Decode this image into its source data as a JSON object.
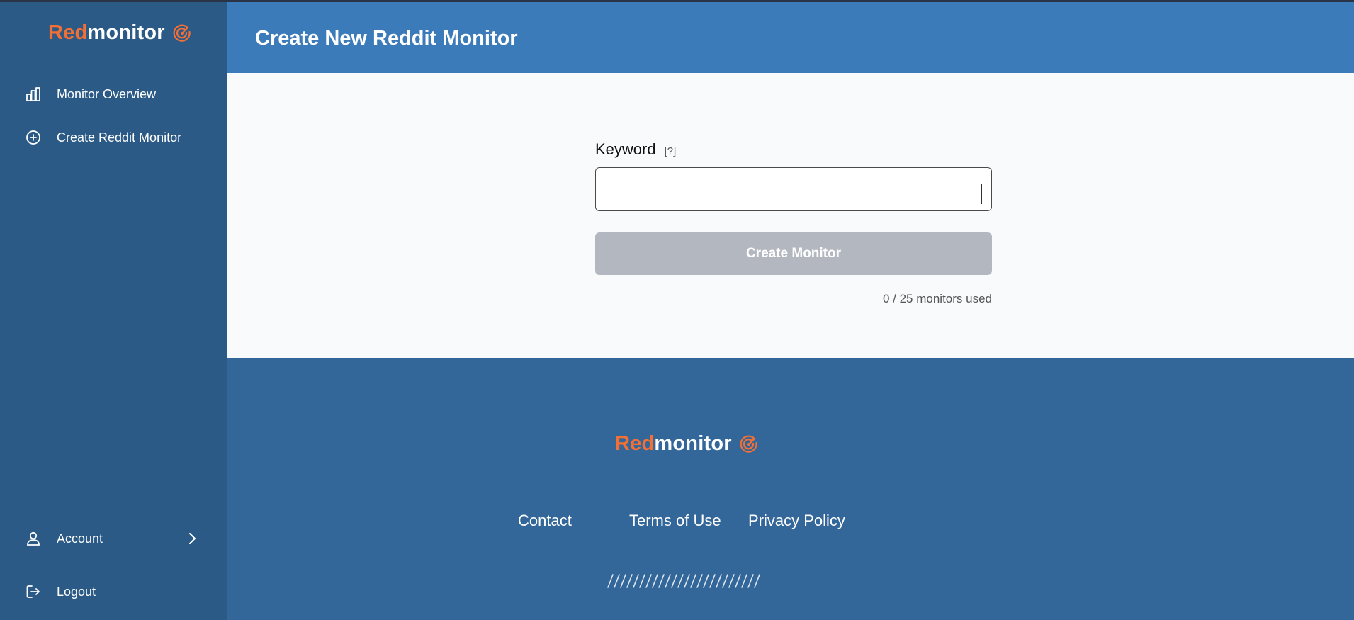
{
  "brand": {
    "part1": "Red",
    "part2": "monitor",
    "accent": "#f26f36"
  },
  "sidebar": {
    "items": [
      {
        "label": "Monitor Overview",
        "icon": "bar-chart-icon"
      },
      {
        "label": "Create Reddit Monitor",
        "icon": "plus-circle-icon"
      }
    ],
    "bottom": [
      {
        "label": "Account",
        "icon": "user-icon"
      },
      {
        "label": "Logout",
        "icon": "logout-icon"
      }
    ]
  },
  "header": {
    "title": "Create New Reddit Monitor"
  },
  "form": {
    "keyword_label": "Keyword",
    "help": "[?]",
    "keyword_value": "",
    "submit_label": "Create Monitor",
    "usage": "0 / 25 monitors used"
  },
  "footer": {
    "links": {
      "contact": "Contact",
      "terms": "Terms of Use",
      "privacy": "Privacy Policy"
    }
  },
  "colors": {
    "sidebar": "#2b5a86",
    "header": "#3c7bb9",
    "footer": "#336699",
    "button_disabled": "#b3b7bf"
  }
}
